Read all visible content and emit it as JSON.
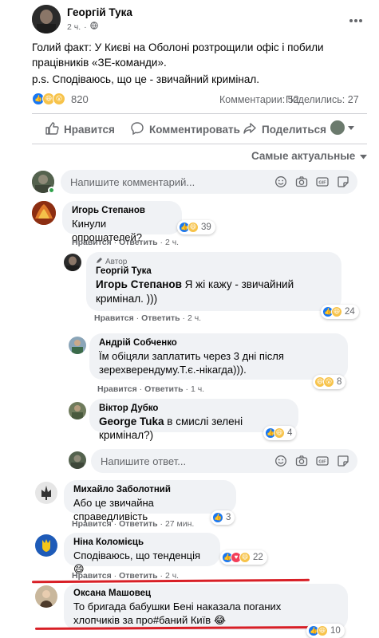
{
  "post": {
    "author": "Георгій Тука",
    "time": "2 ч.",
    "privacy_icon": "globe-icon",
    "text": "Голий факт: У Києві на Оболоні розтрощили офіс і побили працівників «ЗЕ-команди».",
    "ps": "p.s. Сподіваюсь, що це - звичайний кримінал.",
    "reactions_count": "820",
    "comments": "Комментарии: 52",
    "shares": "Поделились: 27"
  },
  "actions": {
    "like": "Нравится",
    "comment": "Комментировать",
    "share": "Поделиться"
  },
  "sort": {
    "label": "Самые актуальные"
  },
  "composer": {
    "placeholder": "Напишите комментарий..."
  },
  "reply_composer": {
    "placeholder": "Напишите ответ..."
  },
  "comment_actions": {
    "like": "Нравится",
    "reply": "Ответить",
    "sep": "·"
  },
  "comments": [
    {
      "name": "Игорь Степанов",
      "text": "Кинули опрошателей?",
      "reactions": "39",
      "time": "2 ч."
    },
    {
      "author_tag": "Автор",
      "name": "Георгій Тука",
      "mention": "Игорь Степанов",
      "text": " Я жі кажу - звичайний кримінал. )))",
      "reactions": "24",
      "time": "2 ч."
    },
    {
      "name": "Андрій Собченко",
      "text": "Їм обіцяли заплатить через 3 дні після зерехверендуму.Т.є.-нікагда))).",
      "reactions": "8",
      "time": "1 ч."
    },
    {
      "name": "Віктор Дубко",
      "mention": "George Tuka",
      "text": " в смислі зелені кримінал?)",
      "reactions": "4",
      "time": ""
    },
    {
      "name": "Михайло Заболотний",
      "text": "Або це звичайна справедливість",
      "reactions": "3",
      "time": "27 мин."
    },
    {
      "name": "Ніна Коломієць",
      "text": "Сподіваюсь, що тенденція 😄",
      "reactions": "22",
      "time": "2 ч."
    },
    {
      "name": "Оксана Машовец",
      "text": "То бригада бабушки Бені наказала поганих хлопчиків за про#баний Київ 😂",
      "reactions": "10",
      "time": ""
    }
  ],
  "colors": {
    "facebook_blue": "#1877f2",
    "annotation_red": "#d81f26"
  }
}
